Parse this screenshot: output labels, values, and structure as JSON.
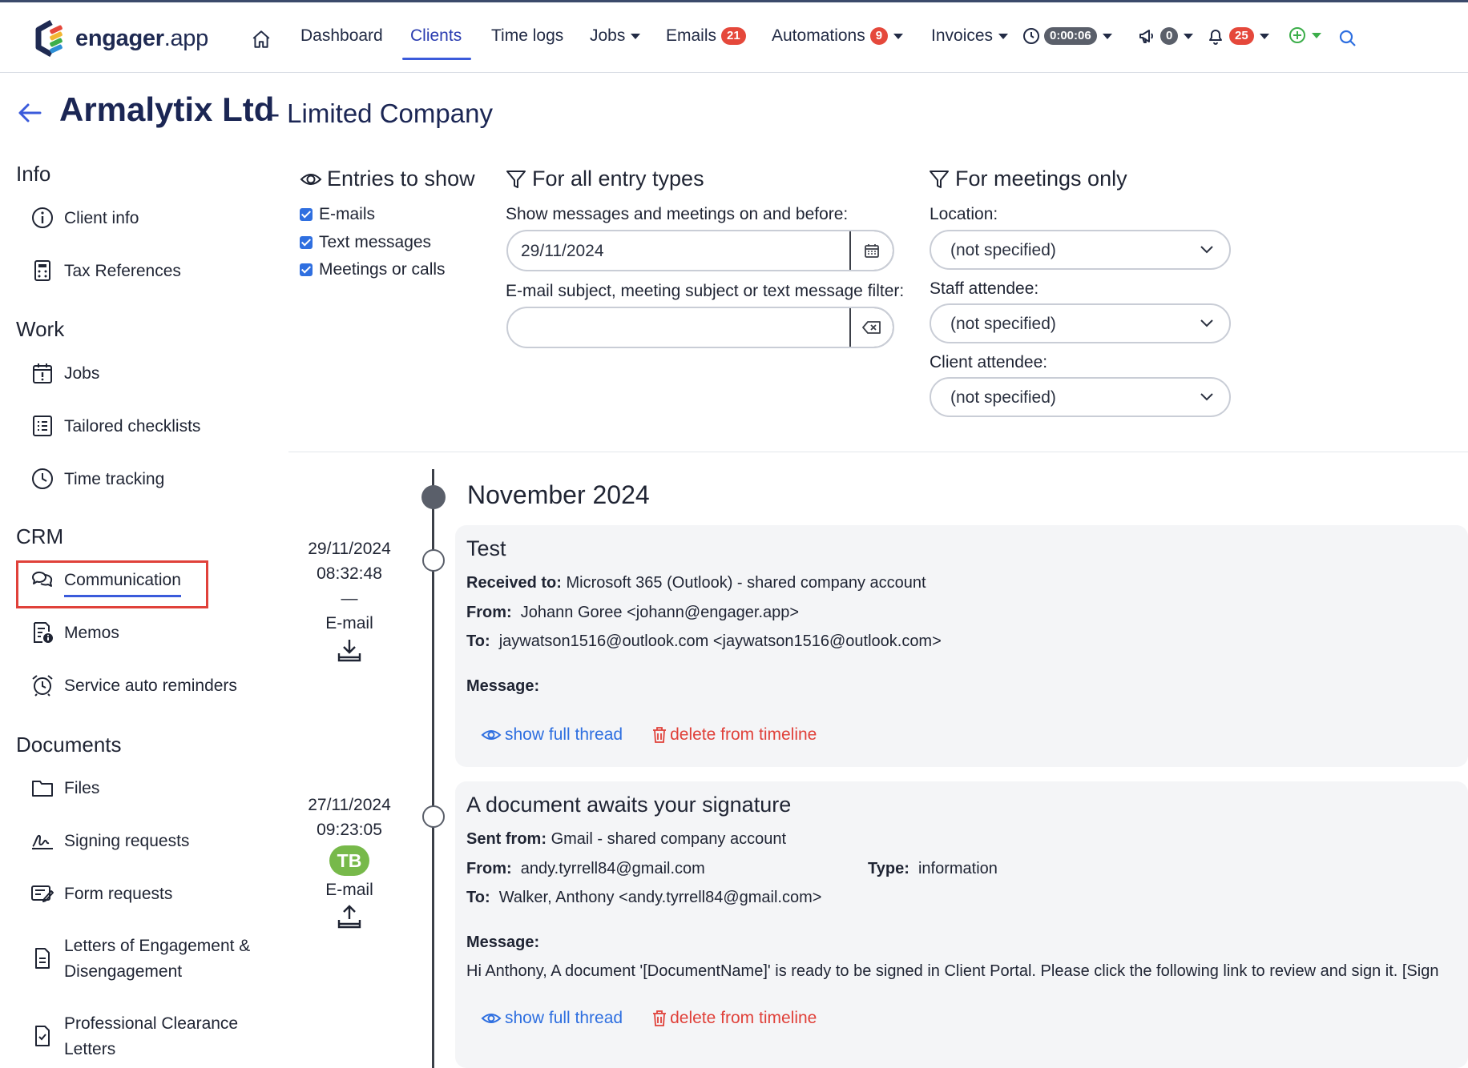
{
  "nav": {
    "logo_brand": "engager",
    "logo_suffix": ".app",
    "dashboard": "Dashboard",
    "clients": "Clients",
    "time_logs": "Time logs",
    "jobs": "Jobs",
    "emails": "Emails",
    "emails_count": "21",
    "automations": "Automations",
    "automations_count": "9",
    "invoices": "Invoices",
    "timer": "0:00:06",
    "announcements_count": "0",
    "notifications_count": "25"
  },
  "header": {
    "title": "Armalytix Ltd",
    "subtitle": "- Limited Company"
  },
  "sidebar": {
    "info_heading": "Info",
    "client_info": "Client info",
    "tax_references": "Tax References",
    "work_heading": "Work",
    "jobs": "Jobs",
    "tailored_checklists": "Tailored checklists",
    "time_tracking": "Time tracking",
    "crm_heading": "CRM",
    "communication": "Communication",
    "memos": "Memos",
    "service_auto_reminders": "Service auto reminders",
    "documents_heading": "Documents",
    "files": "Files",
    "signing_requests": "Signing requests",
    "form_requests": "Form requests",
    "letters_line1": "Letters of Engagement &",
    "letters_line2": "Disengagement",
    "clearance_line1": "Professional Clearance",
    "clearance_line2": "Letters"
  },
  "filters": {
    "entries_heading": "Entries to show",
    "emails": "E-mails",
    "text_messages": "Text messages",
    "meetings": "Meetings or calls",
    "all_types_heading": "For all entry types",
    "date_label": "Show messages and meetings on and before:",
    "date_value": "29/11/2024",
    "subject_label": "E-mail subject, meeting subject or text message filter:",
    "subject_value": "",
    "meetings_heading": "For meetings only",
    "location_label": "Location:",
    "location_value": "(not specified)",
    "staff_label": "Staff attendee:",
    "staff_value": "(not specified)",
    "client_label": "Client attendee:",
    "client_value": "(not specified)"
  },
  "timeline": {
    "month": "November 2024",
    "entries": [
      {
        "date": "29/11/2024",
        "time": "08:32:48",
        "dash": "—",
        "type": "E-mail",
        "title": "Test",
        "route_label": "Received to:",
        "route_value": "Microsoft 365 (Outlook) - shared company account",
        "from_label": "From:",
        "from_value": "Johann Goree <johann@engager.app>",
        "to_label": "To:",
        "to_value": "jaywatson1516@outlook.com <jaywatson1516@outlook.com>",
        "message_label": "Message:",
        "show_thread": "show full thread",
        "delete": "delete from timeline"
      },
      {
        "date": "27/11/2024",
        "time": "09:23:05",
        "avatar": "TB",
        "type": "E-mail",
        "title": "A document awaits your signature",
        "route_label": "Sent from:",
        "route_value": "Gmail - shared company account",
        "from_label": "From:",
        "from_value": "andy.tyrrell84@gmail.com",
        "type_label": "Type:",
        "type_value": "information",
        "to_label": "To:",
        "to_value": "Walker, Anthony <andy.tyrrell84@gmail.com>",
        "message_label": "Message:",
        "message_value": "Hi Anthony, A document '[DocumentName]' is ready to be signed in Client Portal. Please click the following link to review and sign it.   [Sign",
        "show_thread": "show full thread",
        "delete": "delete from timeline"
      }
    ]
  },
  "colors": {
    "accent": "#3b5bdb",
    "danger": "#e0413a",
    "link": "#2e6fe0",
    "navy": "#1b2654"
  }
}
